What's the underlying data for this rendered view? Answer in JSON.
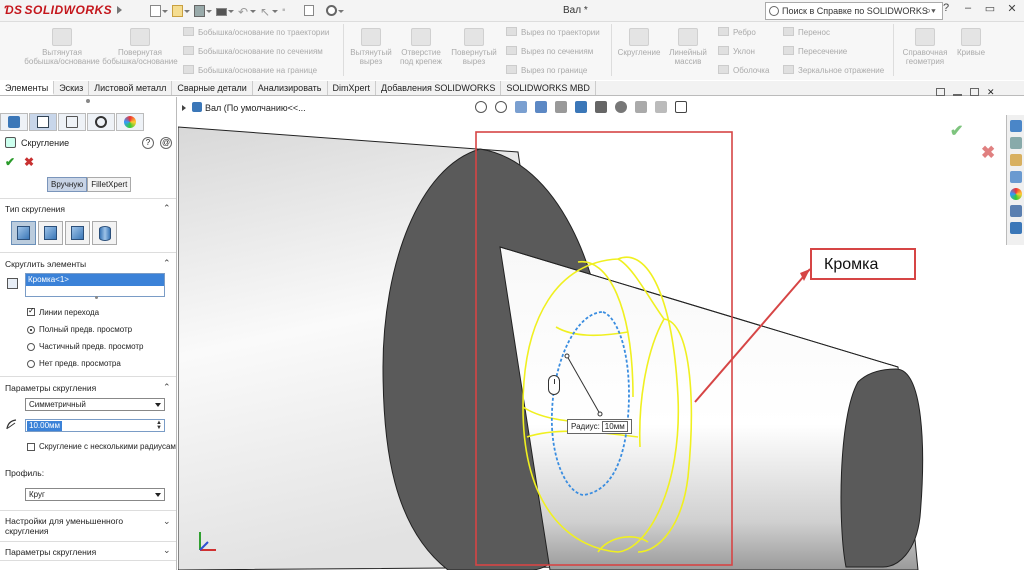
{
  "app": {
    "logo": "SOLIDWORKS",
    "doc_title": "Вал *",
    "help_search": "Поиск в Справке по SOLIDWORKS",
    "window_controls": [
      "?",
      "–",
      "▭",
      "✕"
    ]
  },
  "ribbon": {
    "buttons": [
      {
        "label_1": "Вытянутая",
        "label_2": "бобышка/основание"
      },
      {
        "label_1": "Повернутая",
        "label_2": "бобышка/основание"
      },
      {
        "label_1": "Вытянутый",
        "label_2": "вырез"
      },
      {
        "label_1": "Отверстие",
        "label_2": "под крепеж"
      },
      {
        "label_1": "Повернутый",
        "label_2": "вырез"
      },
      {
        "label_1": "Скругление",
        "label_2": ""
      },
      {
        "label_1": "Линейный",
        "label_2": "массив"
      },
      {
        "label_1": "Справочная",
        "label_2": "геометрия"
      },
      {
        "label_1": "Кривые",
        "label_2": ""
      }
    ],
    "small": [
      "Бобышка/основание по траектории",
      "Бобышка/основание по сечениям",
      "Бобышка/основание на границе",
      "Вырез по траектории",
      "Вырез по сечениям",
      "Вырез по границе",
      "Ребро",
      "Уклон",
      "Оболочка",
      "Перенос",
      "Пересечение",
      "Зеркальное отражение"
    ]
  },
  "command_tabs": [
    "Элементы",
    "Эскиз",
    "Листовой металл",
    "Сварные детали",
    "Анализировать",
    "DimXpert",
    "Добавления SOLIDWORKS",
    "SOLIDWORKS MBD"
  ],
  "property_manager": {
    "title": "Скругление",
    "help_glyphs": [
      "?",
      "@"
    ],
    "ok": "✔",
    "cancel": "✖",
    "modes": [
      "Вручную",
      "FilletXpert"
    ],
    "fillet_type": {
      "header": "Тип скругления"
    },
    "items": {
      "header": "Скруглить элементы",
      "selected": "Кромка<1>",
      "tangent_propagation": "Линии перехода",
      "tangent_propagation_checked": true,
      "preview_options": [
        "Полный предв. просмотр",
        "Частичный предв. просмотр",
        "Нет предв. просмотра"
      ],
      "preview_selected": "Полный предв. просмотр"
    },
    "params": {
      "header": "Параметры скругления",
      "type_value": "Симметричный",
      "radius": "10.00мм",
      "multi_radius": "Скругление с несколькими радиусами",
      "multi_radius_checked": false,
      "profile_label": "Профиль:",
      "profile_value": "Круг"
    },
    "sections_collapsed": [
      {
        "label_1": "Настройки для уменьшенного",
        "label_2": "скругления"
      },
      {
        "label_1": "Параметры скругления",
        "label_2": ""
      }
    ]
  },
  "viewport": {
    "tree_item": "Вал  (По умолчанию<<...",
    "callout": "Кромка",
    "radius_tag_label": "Радиус:",
    "radius_tag_value": "10мм",
    "edge_color": "#f0f020",
    "callout_color": "#d64545",
    "preview_color": "#3a8de0"
  }
}
